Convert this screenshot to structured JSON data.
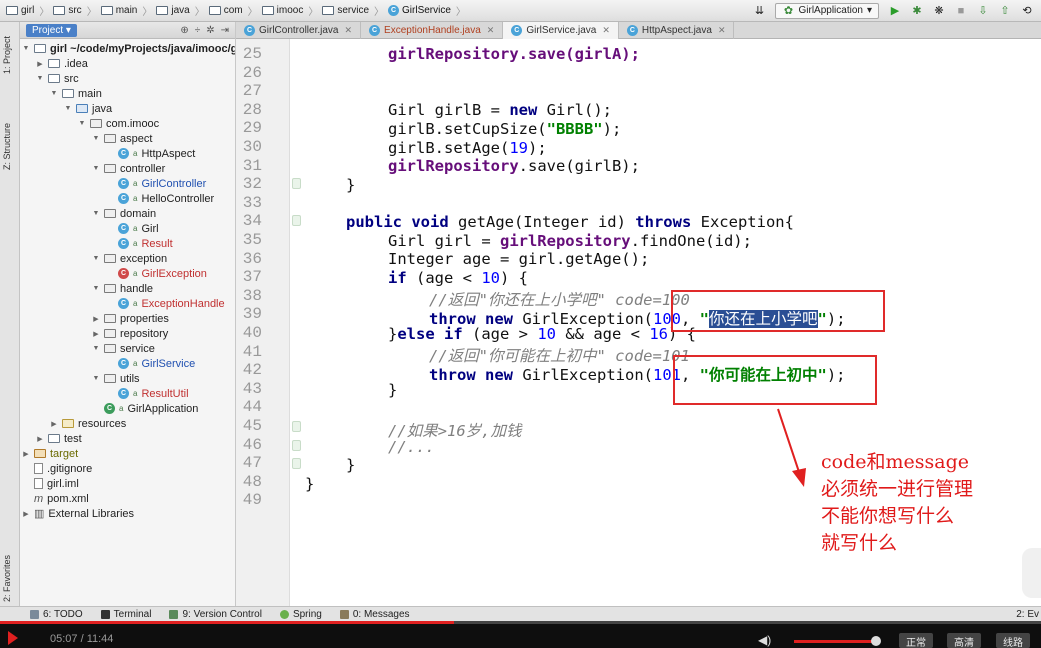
{
  "breadcrumb": [
    "girl",
    "src",
    "main",
    "java",
    "com",
    "imooc",
    "service",
    "GirlService"
  ],
  "toolbar": {
    "run_config": "GirlApplication"
  },
  "project_panel": {
    "tab_label": "1: Project",
    "header_label": "Project",
    "root": "girl ~/code/myProjects/java/imooc/g",
    "items": [
      ".idea",
      "src",
      "main",
      "java",
      "com.imooc",
      "aspect",
      "HttpAspect",
      "controller",
      "GirlController",
      "HelloController",
      "domain",
      "Girl",
      "Result",
      "exception",
      "GirlException",
      "handle",
      "ExceptionHandle",
      "properties",
      "repository",
      "service",
      "GirlService",
      "utils",
      "ResultUtil",
      "GirlApplication",
      "resources",
      "test",
      "target",
      ".gitignore",
      "girl.iml",
      "pom.xml",
      "External Libraries"
    ]
  },
  "left_strip": {
    "structure": "Z: Structure",
    "favorites": "2: Favorites"
  },
  "editor_tabs": [
    "GirlController.java",
    "ExceptionHandle.java",
    "GirlService.java",
    "HttpAspect.java"
  ],
  "active_tab": "GirlService.java",
  "line_numbers": [
    "25",
    "26",
    "27",
    "28",
    "29",
    "30",
    "31",
    "32",
    "33",
    "34",
    "35",
    "36",
    "37",
    "38",
    "39",
    "40",
    "41",
    "42",
    "43",
    "44",
    "45",
    "46",
    "47",
    "48",
    "49"
  ],
  "code": {
    "l25": "girlRepository.save(girlA);",
    "l28a": "Girl girlB = ",
    "l28kw": "new",
    "l28b": " Girl();",
    "l29a": "girlB.setCupSize(",
    "l29s": "\"BBBB\"",
    "l29b": ");",
    "l30a": "girlB.setAge(",
    "l30n": "19",
    "l30b": ");",
    "l31f": "girlRepository",
    "l31b": ".save(girlB);",
    "l32": "}",
    "l34a": "public void",
    "l34b": " getAge(Integer id) ",
    "l34c": "throws",
    "l34d": " Exception{",
    "l35a": "Girl girl = ",
    "l35f": "girlRepository",
    "l35b": ".findOne(id);",
    "l36": "Integer age = girl.getAge();",
    "l37a": "if",
    "l37b": " (age < ",
    "l37n": "10",
    "l37c": ") {",
    "l38": "//返回\"你还在上小学吧\" code=100",
    "l39a": "throw new",
    "l39b": " GirlException(",
    "l39n": "100",
    "l39c": ", ",
    "l39q1": "\"",
    "l39s": "你还在上小学吧",
    "l39q2": "\"",
    "l39d": ");",
    "l40a": "}",
    "l40kw": "else if",
    "l40b": " (age > ",
    "l40n1": "10",
    "l40c": " && age < ",
    "l40n2": "16",
    "l40d": ") {",
    "l41": "//返回\"你可能在上初中\" code=101",
    "l42a": "throw new",
    "l42b": " GirlException(",
    "l42n": "101",
    "l42c": ", ",
    "l42s": "\"你可能在上初中\"",
    "l42d": ");",
    "l43": "}",
    "l45": "//如果>16岁,加钱",
    "l46": "//...",
    "l47": "}",
    "l48": "}"
  },
  "annotation": "code和message\n必须统一进行管理\n不能你想写什么\n就写什么",
  "bottom_tools": [
    "6: TODO",
    "Terminal",
    "9: Version Control",
    "Spring",
    "0: Messages"
  ],
  "bottom_right": "2: Ev",
  "player": {
    "time": "05:07 / 11:44",
    "progress": 0.436,
    "volume": 0.95,
    "quality_buttons": [
      "正常",
      "高清",
      "线路"
    ]
  },
  "colors": {
    "annotation": "#e01a1a",
    "progress": "#e02020",
    "selection": "#2a4e94"
  }
}
